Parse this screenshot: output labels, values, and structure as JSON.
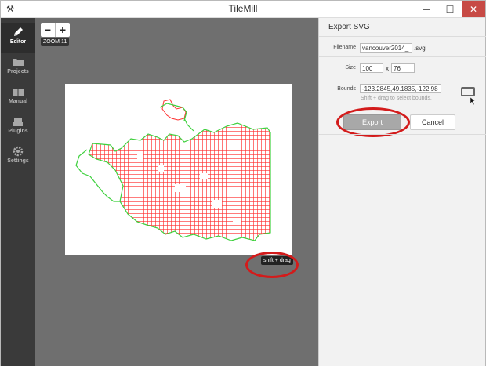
{
  "window": {
    "title": "TileMill",
    "app_icon": "tilemill-icon",
    "minimize": "─",
    "maximize": "☐",
    "close": "✕"
  },
  "sidebar": {
    "items": [
      {
        "label": "Editor",
        "icon": "pencil-icon",
        "active": true
      },
      {
        "label": "Projects",
        "icon": "folder-icon",
        "active": false
      },
      {
        "label": "Manual",
        "icon": "book-icon",
        "active": false
      },
      {
        "label": "Plugins",
        "icon": "plugin-icon",
        "active": false
      },
      {
        "label": "Settings",
        "icon": "gear-icon",
        "active": false
      }
    ]
  },
  "map": {
    "zoom_in": "+",
    "zoom_out": "−",
    "zoom_label": "ZOOM 11",
    "hint": "shift + drag"
  },
  "panel": {
    "title": "Export SVG",
    "filename_label": "Filename",
    "filename_value": "vancouver2014_",
    "filename_suffix": ".svg",
    "size_label": "Size",
    "width_value": "100",
    "size_separator": "x",
    "height_value": "76",
    "bounds_label": "Bounds",
    "bounds_value": "-123.2845,49.1835,-122.98",
    "bounds_help": "Shift + drag to select bounds.",
    "export_button": "Export",
    "cancel_button": "Cancel"
  },
  "colors": {
    "accent_red": "#d31b1b",
    "map_fill": "#ff3b3b",
    "map_outline": "#3fd13f"
  }
}
